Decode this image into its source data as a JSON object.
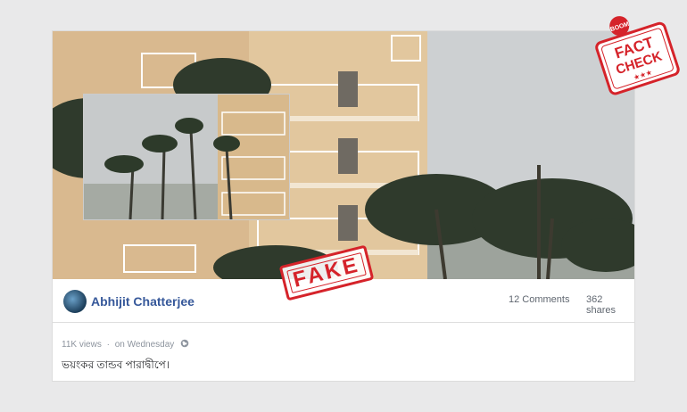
{
  "post": {
    "author_name": "Abhijit Chatterjee",
    "comments": "12 Comments",
    "shares": "362 shares",
    "views": "11K views",
    "separator": "·",
    "time": "on Wednesday",
    "text": "ভয়ংকর তান্ডব পারাদ্বীপে।"
  },
  "stamps": {
    "fake_label": "FAKE",
    "badge_boom": "BOOM",
    "badge_line1": "FACT",
    "badge_line2": "CHECK",
    "badge_stars": "★★★"
  },
  "colors": {
    "author": "#36589a",
    "stamp_red": "#d5232a",
    "meta_grey": "#606770"
  },
  "icons": {
    "visibility": "globe-icon",
    "avatar": "avatar"
  }
}
